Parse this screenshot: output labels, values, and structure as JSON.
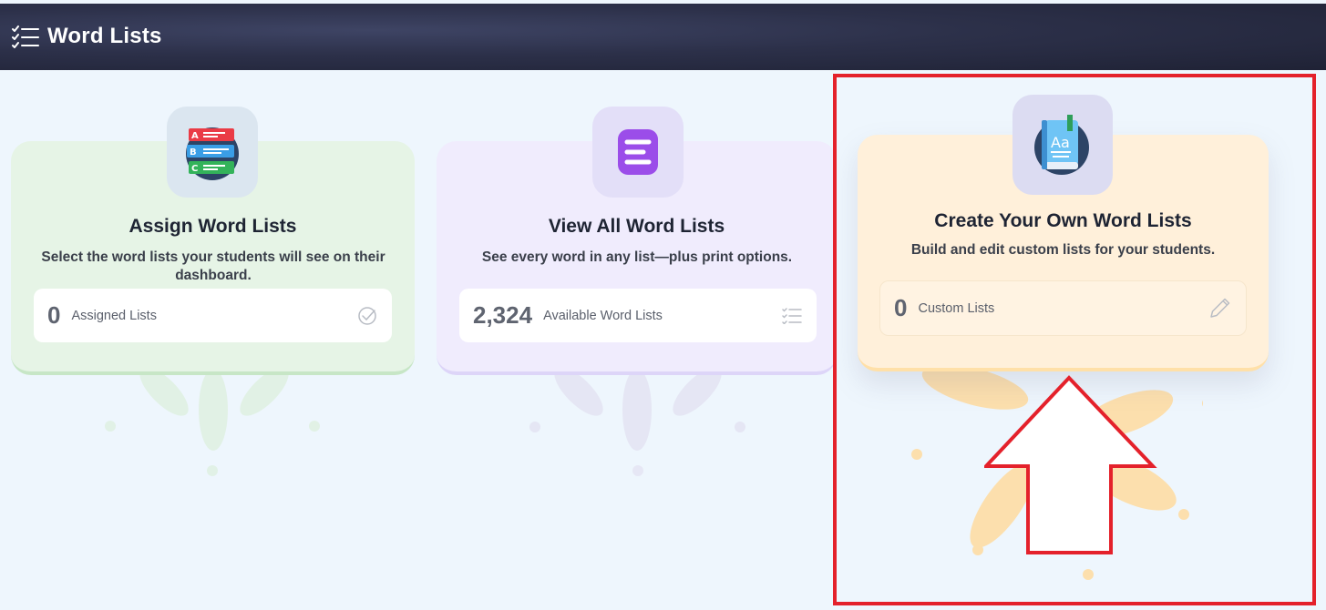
{
  "header": {
    "title": "Word Lists",
    "icon": "list-check-icon"
  },
  "cards": [
    {
      "title": "Assign Word Lists",
      "description": "Select the word lists your students will see on their dashboard.",
      "stat_value": "0",
      "stat_label": "Assigned Lists",
      "icon": "abc-list-icon",
      "stat_icon": "check-circle-icon"
    },
    {
      "title": "View All Word Lists",
      "description": "See every word in any list—plus print options.",
      "stat_value": "2,324",
      "stat_label": "Available Word Lists",
      "icon": "text-lines-icon",
      "stat_icon": "list-icon"
    },
    {
      "title": "Create Your Own Word Lists",
      "description": "Build and edit custom lists for your students.",
      "stat_value": "0",
      "stat_label": "Custom Lists",
      "icon": "book-icon",
      "stat_icon": "pencil-icon"
    }
  ],
  "colors": {
    "header_bg": "#2c3049",
    "highlight": "#e4212b",
    "green_card": "#e6f4e6",
    "purple_card": "#f0ecfd",
    "orange_card": "#fff0da"
  }
}
